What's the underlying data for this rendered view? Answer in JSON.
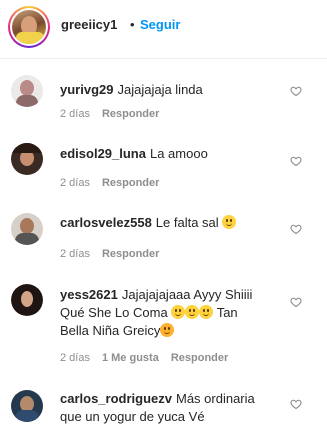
{
  "header": {
    "username": "greeiicy1",
    "dot": "•",
    "follow_label": "Seguir"
  },
  "comments": [
    {
      "user": "yurivg29",
      "text": "Jajajajaja linda",
      "time": "2 días",
      "reply": "Responder",
      "likes": ""
    },
    {
      "user": "edisol29_luna",
      "text": "La amooo",
      "time": "2 días",
      "reply": "Responder",
      "likes": ""
    },
    {
      "user": "carlosvelez558",
      "text": "Le falta sal",
      "time": "2 días",
      "reply": "Responder",
      "likes": ""
    },
    {
      "user": "yess2621",
      "text_line1": "Jajajajajaaa Ayyy Shiiii",
      "text_line2": "Qué She Lo Coma",
      "text_line3a": "Tan",
      "text_line3b": "Bella Niña Greicy",
      "time": "2 días",
      "likes": "1 Me gusta",
      "reply": "Responder"
    },
    {
      "user": "carlos_rodriguezv",
      "text_line1": "Más ordinaria",
      "text_line2": "que un yogur de yuca Vé",
      "time": "",
      "reply": ""
    }
  ]
}
